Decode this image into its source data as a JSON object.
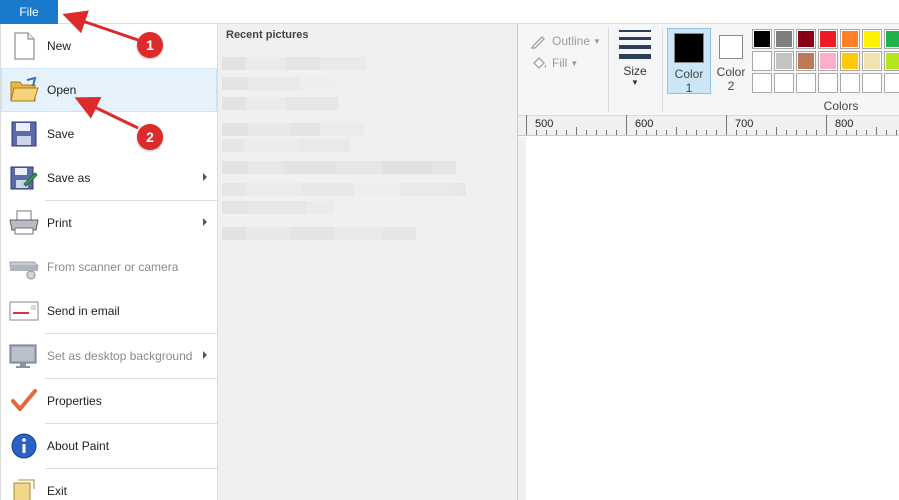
{
  "file_tab": {
    "label": "File"
  },
  "file_menu": {
    "items": [
      {
        "label": "New",
        "icon": "new-document-icon"
      },
      {
        "label": "Open",
        "icon": "open-folder-icon"
      },
      {
        "label": "Save",
        "icon": "floppy-disk-icon"
      },
      {
        "label": "Save as",
        "icon": "save-as-icon"
      },
      {
        "label": "Print",
        "icon": "printer-icon"
      },
      {
        "label": "From scanner or camera",
        "icon": "scanner-icon"
      },
      {
        "label": "Send in email",
        "icon": "envelope-icon"
      },
      {
        "label": "Set as desktop background",
        "icon": "desktop-icon"
      },
      {
        "label": "Properties",
        "icon": "checkmark-icon"
      },
      {
        "label": "About Paint",
        "icon": "info-icon"
      },
      {
        "label": "Exit",
        "icon": "exit-icon"
      }
    ]
  },
  "recent": {
    "title": "Recent pictures"
  },
  "ribbon": {
    "outline_label": "Outline",
    "fill_label": "Fill",
    "size_label": "Size",
    "color1_label": "Color",
    "color1_num": "1",
    "color2_label": "Color",
    "color2_num": "2",
    "colors_group_label": "Colors",
    "color1_value": "#000000",
    "color2_value": "#ffffff",
    "palette": [
      "#000000",
      "#7f7f7f",
      "#880015",
      "#ed1c24",
      "#ff7f27",
      "#fff200",
      "#22b14c",
      "#ffffff",
      "#c3c3c3",
      "#b97a57",
      "#ffaec9",
      "#ffc90e",
      "#efe4b0",
      "#b5e61d",
      "#ffffff",
      "#ffffff",
      "#ffffff",
      "#ffffff",
      "#ffffff",
      "#ffffff",
      "#ffffff"
    ]
  },
  "ruler": {
    "labels": [
      "500",
      "600",
      "700",
      "800"
    ]
  },
  "annotations": {
    "badge1": "1",
    "badge2": "2",
    "color": "#dd2a2a"
  }
}
